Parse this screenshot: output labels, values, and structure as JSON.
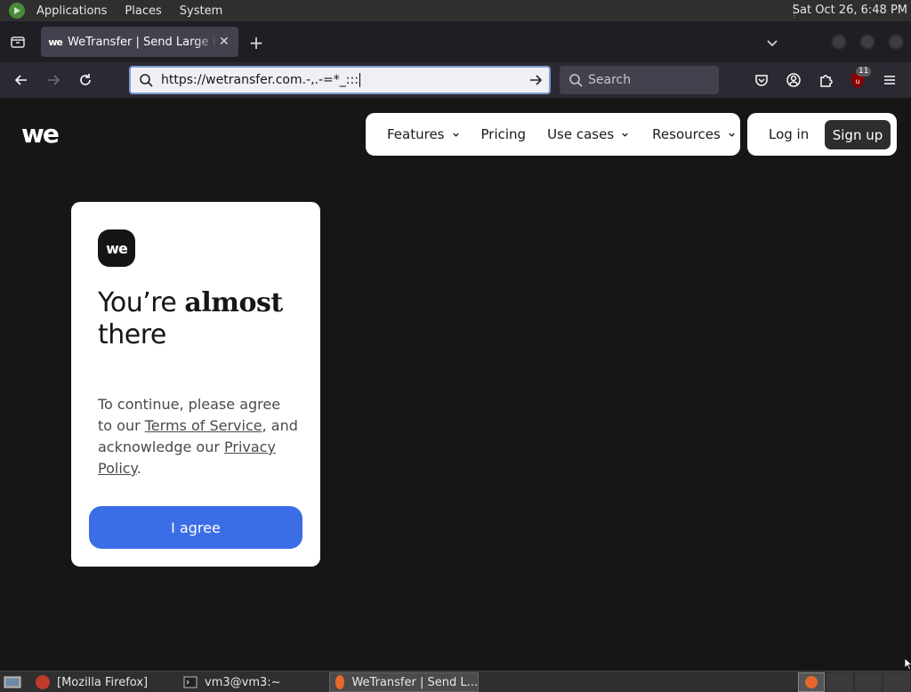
{
  "system_panel": {
    "menus": [
      "Applications",
      "Places",
      "System"
    ],
    "clock": "Sat Oct 26,  6:48 PM"
  },
  "browser": {
    "tab": {
      "title": "WeTransfer | Send Large Files",
      "favicon": "we"
    },
    "url": "https://wetransfer.com.-,.-=*_:::",
    "search_placeholder": "Search",
    "ublock_badge": "11"
  },
  "site": {
    "logo": "we",
    "nav": {
      "features": "Features",
      "pricing": "Pricing",
      "use_cases": "Use cases",
      "resources": "Resources"
    },
    "auth": {
      "login": "Log in",
      "signup": "Sign up"
    }
  },
  "consent_card": {
    "logo": "we",
    "heading_part1": "You’re ",
    "heading_bold": "almost",
    "heading_part2": "there",
    "text_part1": "To continue, please agree to our ",
    "terms_link": "Terms of Service",
    "text_part2": ", and acknowledge our ",
    "privacy_link": "Privacy Policy",
    "text_part3": ".",
    "agree_button": "I agree"
  },
  "taskbar": {
    "tasks": [
      "[Mozilla Firefox]",
      "vm3@vm3:~",
      "WeTransfer | Send L..."
    ]
  },
  "colors": {
    "accent_button": "#3b6de6",
    "page_background": "#161616",
    "urlbar_focus": "#7c9cd6"
  }
}
